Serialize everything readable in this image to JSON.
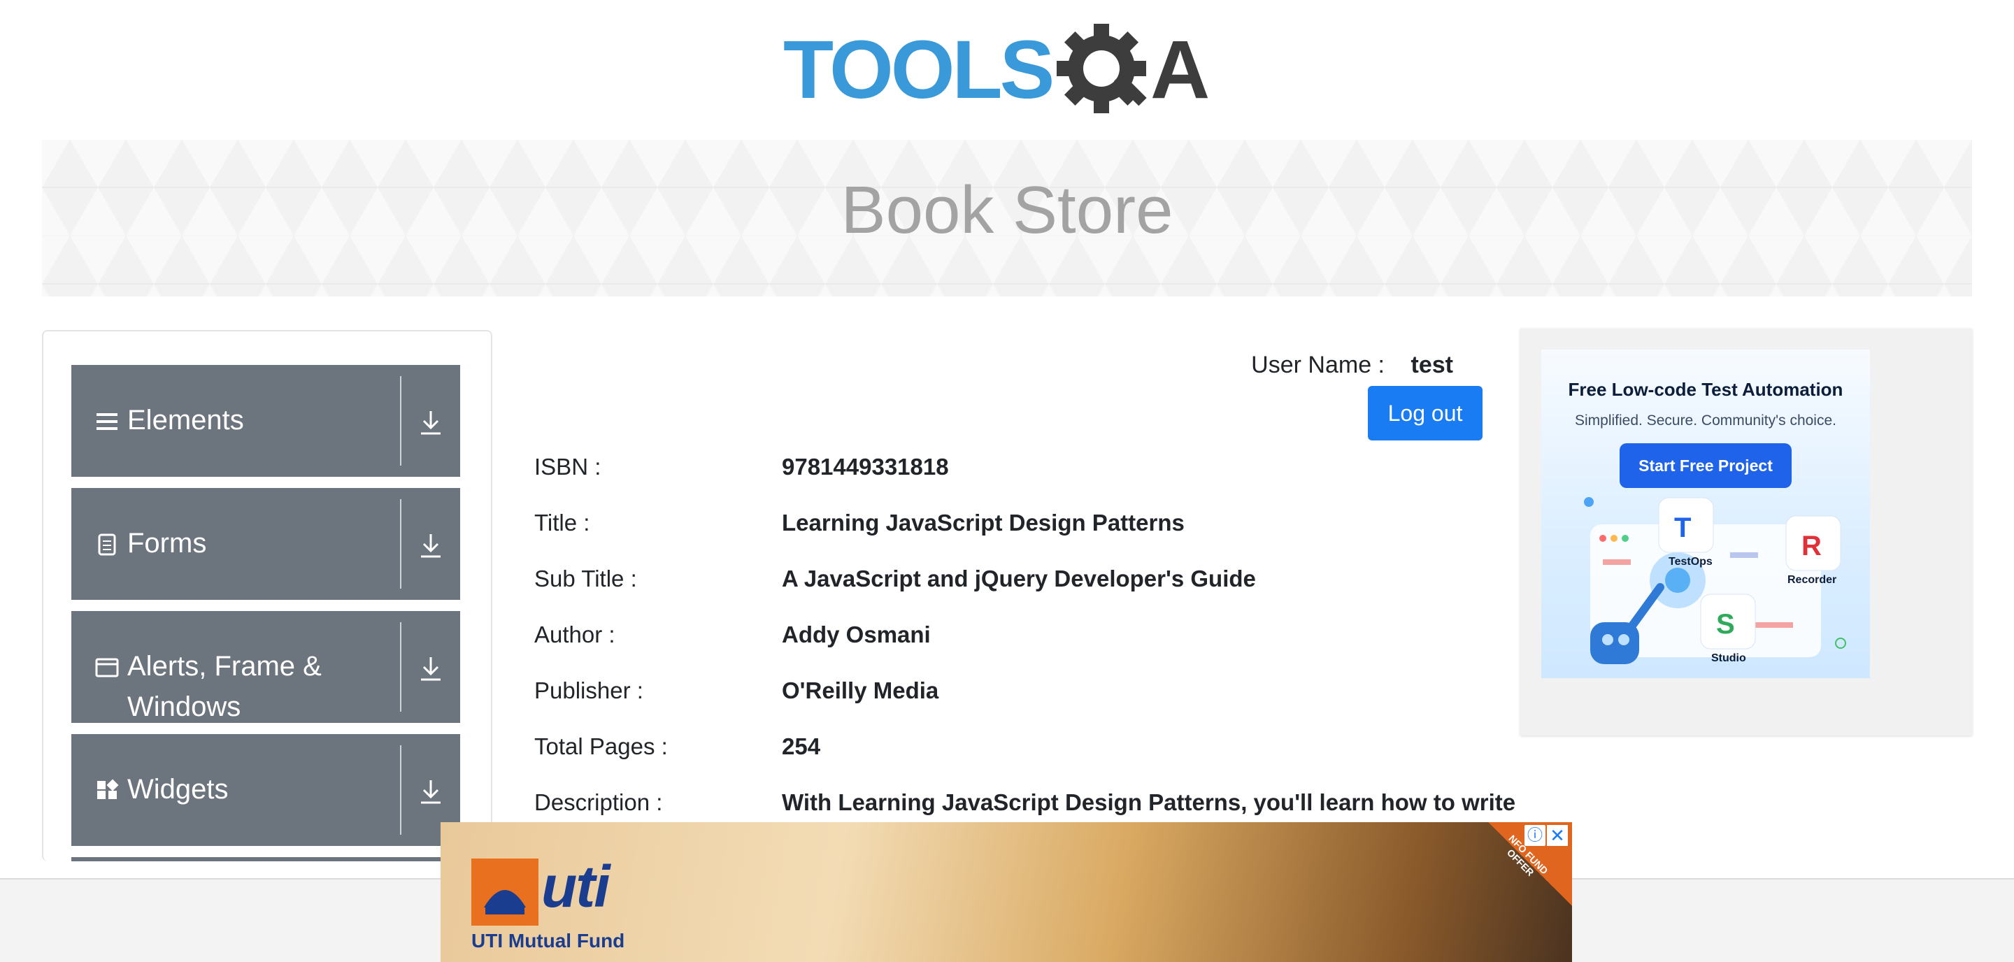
{
  "logo": {
    "text_tools": "TOOLS",
    "text_qa": "QA"
  },
  "banner": {
    "title": "Book Store"
  },
  "sidebar": {
    "groups": [
      {
        "label": "Elements",
        "icon": "hamburger-icon"
      },
      {
        "label": "Forms",
        "icon": "document-icon"
      },
      {
        "label": "Alerts, Frame & Windows",
        "icon": "window-icon"
      },
      {
        "label": "Widgets",
        "icon": "widgets-icon"
      }
    ]
  },
  "user": {
    "label": "User Name :",
    "value": "test",
    "logout_label": "Log out"
  },
  "book": {
    "fields": [
      {
        "label": "ISBN :",
        "value": "9781449331818"
      },
      {
        "label": "Title :",
        "value": "Learning JavaScript Design Patterns"
      },
      {
        "label": "Sub Title :",
        "value": "A JavaScript and jQuery Developer's Guide"
      },
      {
        "label": "Author :",
        "value": "Addy Osmani"
      },
      {
        "label": "Publisher :",
        "value": "O'Reilly Media"
      },
      {
        "label": "Total Pages :",
        "value": "254"
      },
      {
        "label": "Description :",
        "value": "With Learning JavaScript Design Patterns, you'll learn how to write"
      }
    ]
  },
  "ad_right": {
    "title": "Free Low-code Test Automation",
    "subtitle": "Simplified. Secure. Community's choice.",
    "button": "Start Free Project",
    "labels": {
      "testops": "TestOps",
      "recorder": "Recorder",
      "studio": "Studio"
    }
  },
  "ad_bottom": {
    "brand": "uti",
    "name": "UTI Mutual Fund",
    "corner": "NFO FUND OFFER",
    "info_icon": "info-icon",
    "close_icon": "close-icon"
  },
  "colors": {
    "sidebar_group": "#6c757d",
    "primary_button": "#1a7cf2",
    "logo_blue": "#3a9ad9",
    "logo_dark": "#3d3d3d"
  }
}
